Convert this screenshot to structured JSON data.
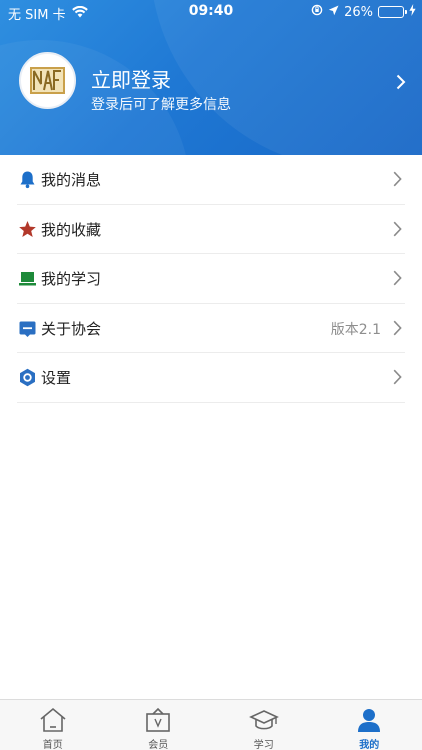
{
  "status_bar": {
    "carrier": "无 SIM 卡",
    "time": "09:40",
    "battery": "26%",
    "battery_level": 0.26
  },
  "profile": {
    "title": "立即登录",
    "subtitle": "登录后可了解更多信息",
    "avatar_logo": "NAFMII"
  },
  "menu": [
    {
      "label": "我的消息",
      "icon": "bell-icon",
      "value": ""
    },
    {
      "label": "我的收藏",
      "icon": "star-icon",
      "value": ""
    },
    {
      "label": "我的学习",
      "icon": "laptop-icon",
      "value": ""
    },
    {
      "label": "关于协会",
      "icon": "info-board-icon",
      "value": "版本2.1"
    },
    {
      "label": "设置",
      "icon": "settings-gear-icon",
      "value": ""
    }
  ],
  "tabbar": {
    "items": [
      {
        "label": "首页",
        "icon": "home-icon"
      },
      {
        "label": "会员",
        "icon": "member-card-icon"
      },
      {
        "label": "学习",
        "icon": "graduation-cap-icon"
      },
      {
        "label": "我的",
        "icon": "person-icon"
      }
    ],
    "active_index": 3
  },
  "colors": {
    "header_blue": "#1f78d4",
    "active_tab": "#1d6fc9",
    "bell": "#1d6fc9",
    "star": "#b2382a",
    "laptop": "#1e8a3a",
    "info": "#2a6fc2",
    "gear": "#2a6fc2"
  }
}
